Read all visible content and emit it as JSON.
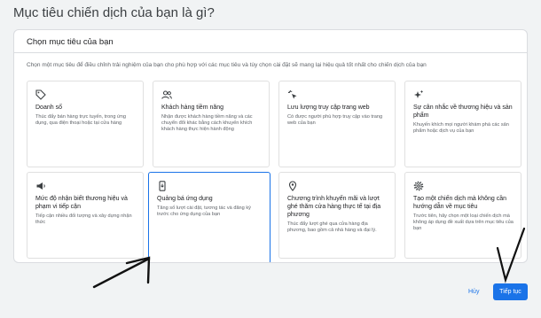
{
  "page": {
    "title": "Mục tiêu chiến dịch của bạn là gì?"
  },
  "panel": {
    "heading": "Chọn mục tiêu của bạn",
    "subtitle": "Chọn một mục tiêu để điều chỉnh trải nghiệm của bạn cho phù hợp với các mục tiêu và tùy chọn cài đặt sẽ mang lại hiệu quả tốt nhất cho chiến dịch của bạn"
  },
  "goals": [
    {
      "icon": "tag-icon",
      "title": "Doanh số",
      "desc": "Thúc đẩy bán hàng trực tuyến, trong ứng dụng, qua điện thoại hoặc tại cửa hàng",
      "selected": false
    },
    {
      "icon": "people-icon",
      "title": "Khách hàng tiềm năng",
      "desc": "Nhận được khách hàng tiềm năng và các chuyển đổi khác bằng cách khuyến khích khách hàng thực hiện hành động",
      "selected": false
    },
    {
      "icon": "cursor-click-icon",
      "title": "Lưu lượng truy cập trang web",
      "desc": "Có được người phù hợp truy cập vào trang web của bạn",
      "selected": false
    },
    {
      "icon": "sparkle-icon",
      "title": "Sự cân nhắc về thương hiệu và sản phẩm",
      "desc": "Khuyến khích mọi người khám phá các sản phẩm hoặc dịch vụ của bạn",
      "selected": false
    },
    {
      "icon": "megaphone-icon",
      "title": "Mức độ nhận biết thương hiệu và phạm vi tiếp cận",
      "desc": "Tiếp cận nhiều đối tượng và xây dựng nhận thức",
      "selected": false
    },
    {
      "icon": "mobile-app-icon",
      "title": "Quảng bá ứng dụng",
      "desc": "Tăng số lượt cài đặt, tương tác và đăng ký trước cho ứng dụng của bạn",
      "selected": true
    },
    {
      "icon": "location-pin-icon",
      "title": "Chương trình khuyến mãi và lượt ghé thăm cửa hàng thực tế tại địa phương",
      "desc": "Thúc đẩy lượt ghé qua cửa hàng địa phương, bao gồm cả nhà hàng và đại lý.",
      "selected": false
    },
    {
      "icon": "gear-icon",
      "title": "Tạo một chiến dịch mà không cần hướng dẫn về mục tiêu",
      "desc": "Trước tiên, hãy chọn một loại chiến dịch mà không áp dụng đề xuất dựa trên mục tiêu của bạn",
      "selected": false
    }
  ],
  "footer": {
    "cancel_label": "Hủy",
    "continue_label": "Tiếp tục"
  },
  "colors": {
    "accent": "#1a73e8",
    "selected_border": "#1a73e8"
  }
}
